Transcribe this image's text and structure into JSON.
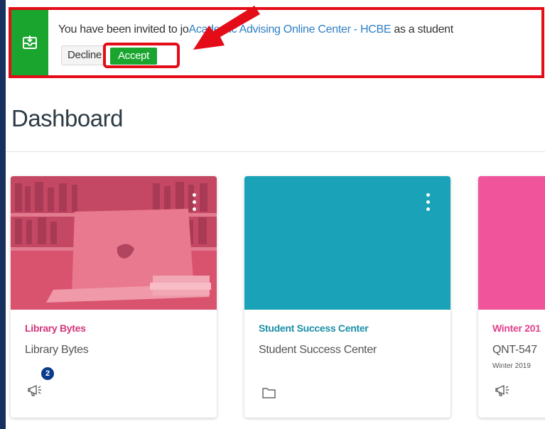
{
  "banner": {
    "text_before": "You have been invited to jo",
    "course_link": "Academic Advising Online Center - HCBE",
    "text_after": " as a student",
    "decline_label": "Decline",
    "accept_label": "Accept",
    "icon": "invitation-envelope-icon"
  },
  "page": {
    "title": "Dashboard"
  },
  "cards": [
    {
      "course_name": "Library Bytes",
      "subtitle": "Library Bytes",
      "term": "",
      "color": "#e0436e",
      "badge_count": "2",
      "icon": "announcement-icon"
    },
    {
      "course_name": "Student Success Center",
      "subtitle": "Student Success Center",
      "term": "",
      "color": "#1aa3b8",
      "icon": "folder-icon"
    },
    {
      "course_name": "Winter 201",
      "subtitle": "QNT-547",
      "term": "Winter 2019",
      "color": "#f0549b",
      "icon": "announcement-icon"
    }
  ],
  "colors": {
    "accent_red": "#e30c17",
    "accept_green": "#1aa52e",
    "link_blue": "#2f7fc4",
    "outer_background": "#18305e"
  }
}
